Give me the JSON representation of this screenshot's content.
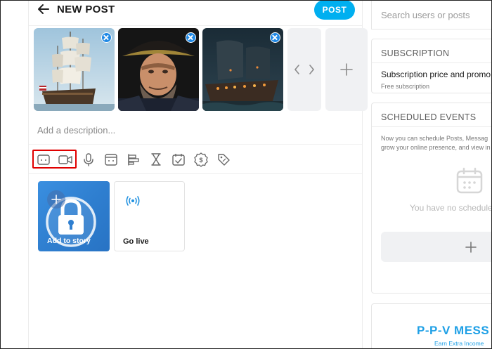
{
  "header": {
    "title": "NEW POST",
    "post_label": "POST"
  },
  "composer": {
    "description_placeholder": "Add a description...",
    "media_count": 3
  },
  "tools": [
    {
      "name": "image-icon"
    },
    {
      "name": "video-icon"
    },
    {
      "name": "microphone-icon"
    },
    {
      "name": "vault-icon"
    },
    {
      "name": "poll-icon"
    },
    {
      "name": "hourglass-icon"
    },
    {
      "name": "calendar-check-icon"
    },
    {
      "name": "price-tag-dollar-icon"
    },
    {
      "name": "tag-icon"
    }
  ],
  "cards": {
    "story_label": "Add to story",
    "live_label": "Go live"
  },
  "sidebar": {
    "search_placeholder": "Search users or posts",
    "subscription": {
      "heading": "SUBSCRIPTION",
      "price_label": "Subscription price and promo",
      "free_label": "Free subscription"
    },
    "scheduled": {
      "heading": "SCHEDULED EVENTS",
      "text_line1": "Now you can schedule Posts, Messag",
      "text_line2": "grow your online presence, and view in",
      "empty_label": "You have no schedule"
    },
    "promo": {
      "title": "P-P-V MESS",
      "subtitle": "Earn Extra Income"
    }
  },
  "colors": {
    "accent": "#00aff0",
    "close_badge": "#1e88e5",
    "highlight": "#e00000",
    "promo": "#1fa0e6"
  }
}
